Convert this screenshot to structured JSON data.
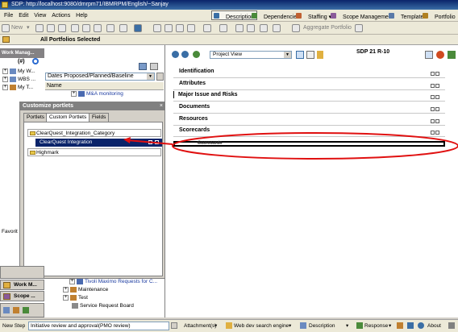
{
  "window": {
    "title": "SDP: http://localhost:9080/dmrpm71/IBMRPM/English/~Sanjay"
  },
  "menu": [
    "File",
    "Edit",
    "View",
    "Actions",
    "Help"
  ],
  "perspectives": [
    "Description",
    "Dependencies",
    "Staffing",
    "Scope Management",
    "Template",
    "Portfolio"
  ],
  "toolbar": {
    "new_label": "New",
    "aggregate_label": "Aggregate Portfolio"
  },
  "portfolio_bar": {
    "label": "All Portfolios Selected"
  },
  "work_manager": {
    "title": "Work Manag...",
    "items": [
      "My W...",
      "WBS ...",
      "My T..."
    ],
    "filter_label": "Dates Proposed/Planned/Baseline",
    "column_header": "Name",
    "subitem": "M&A monitoring",
    "favorites_label": "Favorit"
  },
  "customize": {
    "title": "Customize portlets",
    "tabs": [
      "Portlets",
      "Custom Portlets",
      "Fields"
    ],
    "categories": [
      "ClearQuest_Integration_Category",
      "Highmark"
    ],
    "selected_item": "ClearQuest Integration"
  },
  "lower_tree": [
    "Tivoli Maximo Requests for C...",
    "Maintenance",
    "Test",
    "Service Request Board"
  ],
  "nav": [
    "Work M...",
    "Scope ..."
  ],
  "right": {
    "view_selector": "Project View",
    "record_title": "SDP 21 R-10",
    "sections": [
      "Identification",
      "Attributes",
      "Major Issue and Risks",
      "Documents",
      "Resources",
      "Scorecards"
    ],
    "drop_target_label": "Scorecards"
  },
  "status": {
    "new_step_label": "New Step",
    "step_value": "Initiative review and approval(PMO review)",
    "attachments": "Attachment(s)",
    "search_engine": "Web dev search engine",
    "description": "Description",
    "response": "Response",
    "about": "About"
  },
  "colors": {
    "selection": "#0a246a",
    "annotation_red": "#e01010",
    "title_gradient": "#0a246a"
  }
}
